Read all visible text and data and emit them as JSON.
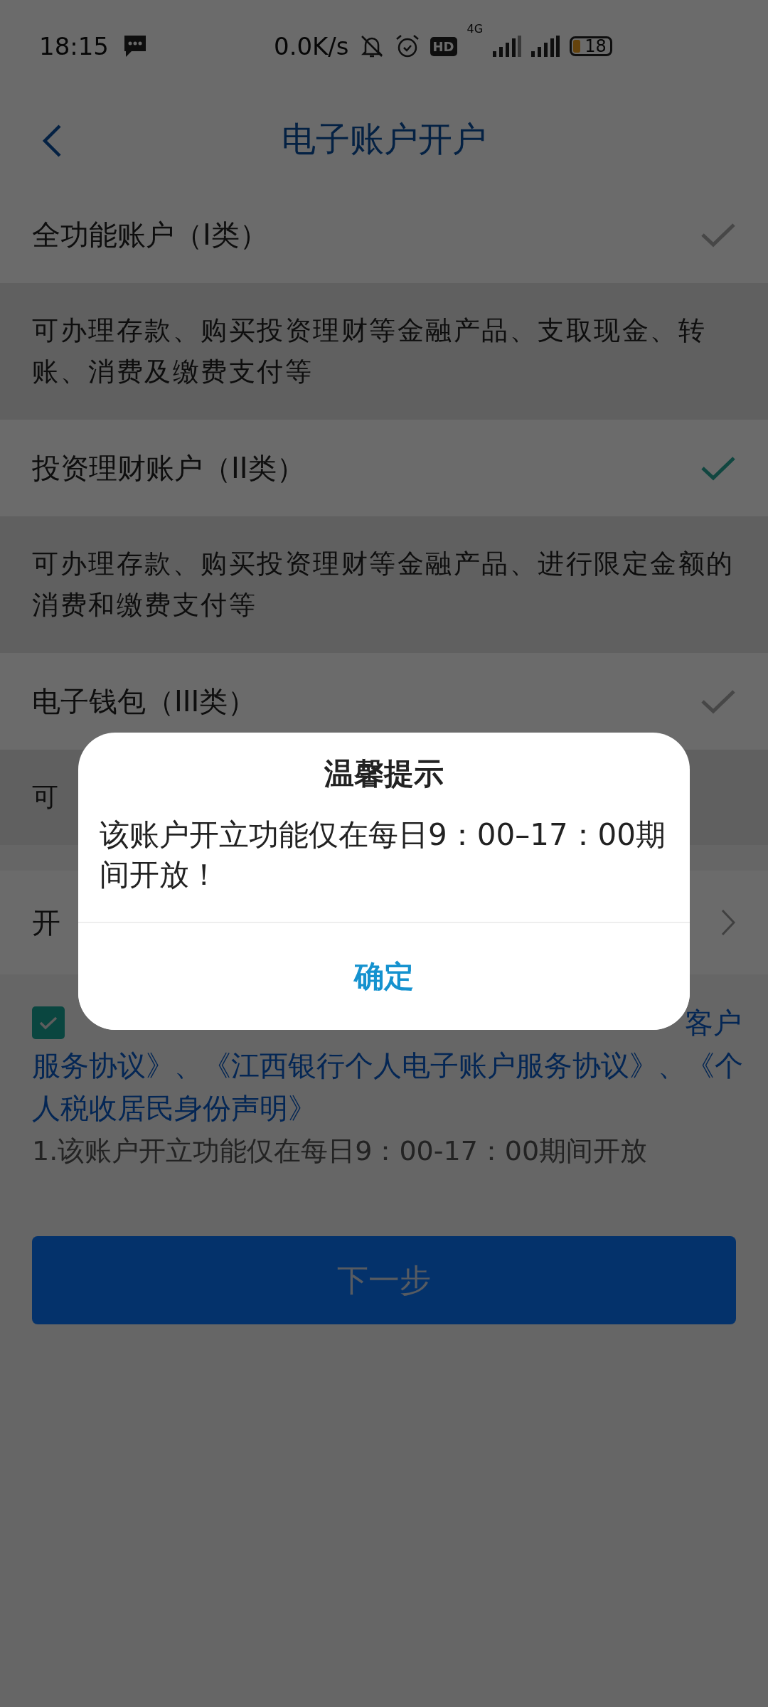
{
  "status_bar": {
    "time": "18:15",
    "network_speed": "0.0K/s",
    "hd_badge": "HD",
    "network_type": "4G",
    "battery": "18"
  },
  "header": {
    "title": "电子账户开户"
  },
  "accounts": [
    {
      "name": "全功能账户（I类）",
      "description": "可办理存款、购买投资理财等金融产品、支取现金、转账、消费及缴费支付等",
      "selected": false
    },
    {
      "name": "投资理财账户（II类）",
      "description": "可办理存款、购买投资理财等金融产品、进行限定金额的消费和缴费支付等",
      "selected": true
    },
    {
      "name": "电子钱包（III类）",
      "description": "可",
      "selected": false
    }
  ],
  "open_row": {
    "label": "开"
  },
  "agreement": {
    "checked": true,
    "text": "客户服务协议》、《江西银行个人电子账户服务协议》、《个人税收居民身份声明》",
    "note": "1.该账户开立功能仅在每日9：00-17：00期间开放"
  },
  "next_button": {
    "label": "下一步"
  },
  "dialog": {
    "title": "温馨提示",
    "message": "该账户开立功能仅在每日9：00–17：00期间开放！",
    "button": "确定"
  }
}
